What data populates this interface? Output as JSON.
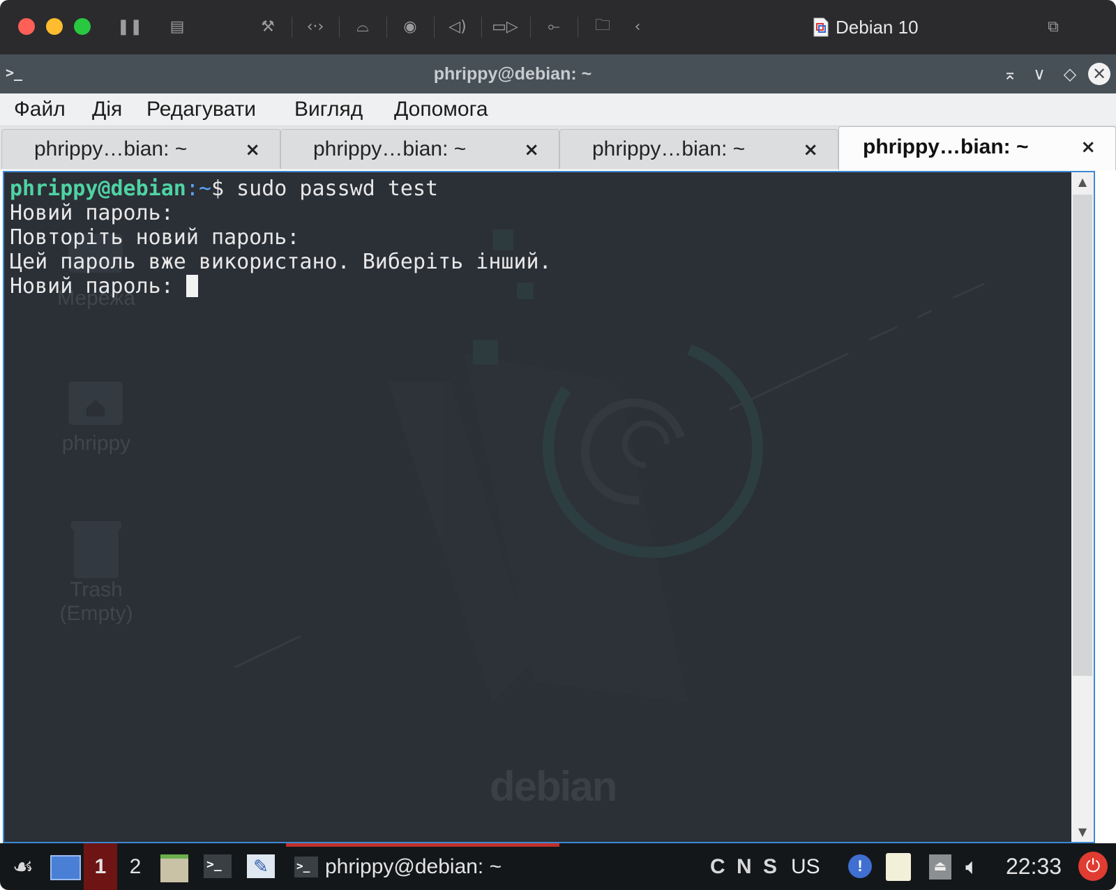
{
  "vm_window": {
    "title": "Debian 10"
  },
  "terminal_window": {
    "title": "phrippy@debian: ~",
    "menu": [
      "Файл",
      "Дія",
      "Редагувати",
      "Вигляд",
      "Допомога"
    ],
    "tabs": [
      {
        "label": "phrippy…bian: ~",
        "close": "×"
      },
      {
        "label": "phrippy…bian: ~",
        "close": "×"
      },
      {
        "label": "phrippy…bian: ~",
        "close": "×"
      },
      {
        "label": "phrippy…bian: ~",
        "close": "×",
        "active": true
      }
    ],
    "prompt": {
      "user_host": "phrippy@debian",
      "path": ":~",
      "symbol": "$ ",
      "command": "sudo passwd test"
    },
    "output": [
      "Новий пароль:",
      "Повторіть новий пароль:",
      "Цей пароль вже використано. Виберіть інший.",
      "Новий пароль: "
    ]
  },
  "desktop": {
    "icons": [
      {
        "label": "Мережа",
        "icon": "network-icon"
      },
      {
        "label": "phrippy",
        "icon": "home-folder-icon"
      },
      {
        "label": "Trash\n(Empty)",
        "icon": "trash-icon"
      }
    ],
    "wallpaper_text": "debian"
  },
  "taskbar": {
    "workspaces": [
      "1",
      "2"
    ],
    "task_label": "phrippy@debian: ~",
    "indicators": "C N S",
    "keyboard_layout": "US",
    "clock": "22:33"
  },
  "colors": {
    "prompt_user": "#4fd3a3",
    "prompt_path": "#5aa5ff",
    "terminal_bg": "#2b2f36",
    "focus_border": "#3c89d6"
  }
}
